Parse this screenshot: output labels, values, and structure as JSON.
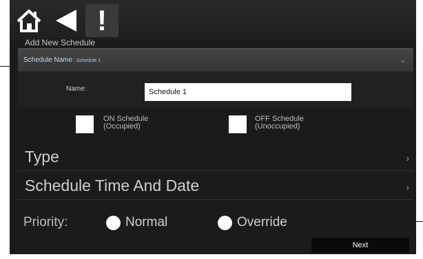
{
  "header": {
    "icons": [
      "home-icon",
      "back-icon",
      "alert-icon"
    ],
    "alert_glyph": "!"
  },
  "section_title": "Add New Schedule",
  "schedule_header": {
    "label": "Schedule Name",
    "separator": " : ",
    "value": "Schedule 1"
  },
  "name_field": {
    "label": "Name:",
    "value": "Schedule 1"
  },
  "schedule_types": {
    "on_line1": "ON Schedule",
    "on_line2": "(Occupied)",
    "off_line1": "OFF Schedule",
    "off_line2": "(Unoccupied)"
  },
  "rows": {
    "type": "Type",
    "time": "Schedule Time And Date"
  },
  "priority": {
    "label": "Priority:",
    "normal": "Normal",
    "override": "Override"
  },
  "next_label": "Next",
  "colors": {
    "background": "#1b1b1b",
    "header_bar": "#3a3a3a",
    "schedule_name_text": "#c4d8ea"
  }
}
